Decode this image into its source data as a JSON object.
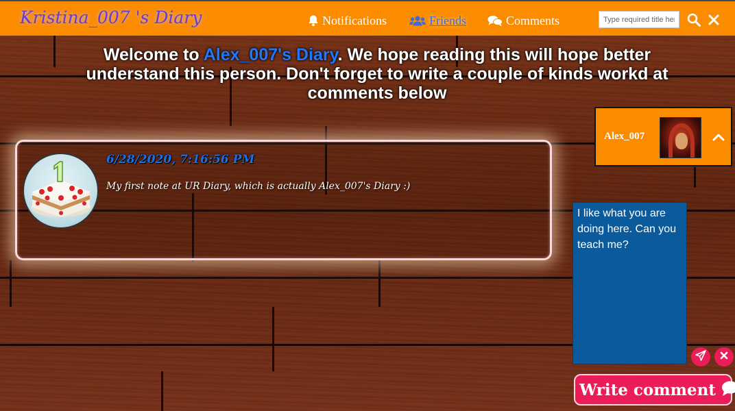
{
  "header": {
    "brand": "Kristina_007 's Diary",
    "nav": {
      "notifications": "Notifications",
      "friends": " Friends",
      "comments": "Comments"
    },
    "title_input_placeholder": "Type required title here"
  },
  "welcome": {
    "prefix": "Welcome to ",
    "diary_name": "Alex_007's Diary",
    "suffix": ". We hope reading this will hope better understand this person. Don't forget to write a couple of kinds workd at comments below"
  },
  "profile": {
    "name": "Alex_007"
  },
  "note": {
    "date": "6/28/2020, 7:16:56 PM",
    "text": "My first note at UR Diary, which is actually Alex_007's Diary :)"
  },
  "comment": {
    "value": "I like what you are doing here. Can you teach me?",
    "write_label": "Write comment"
  },
  "icons": {
    "notifications": "bell-icon",
    "friends": "users-icon",
    "comments": "comments-icon",
    "search": "search-icon",
    "close": "close-icon",
    "collapse": "chevron-up-icon",
    "send": "paper-plane-icon",
    "cancel": "close-icon",
    "write": "comment-bubble-icon"
  },
  "colors": {
    "topbar": "#fb8c00",
    "brand": "#6a3ccf",
    "accent_blue": "#1f79ff",
    "comment_bg": "#0a5a9c",
    "button_pink": "#ea1d58"
  }
}
